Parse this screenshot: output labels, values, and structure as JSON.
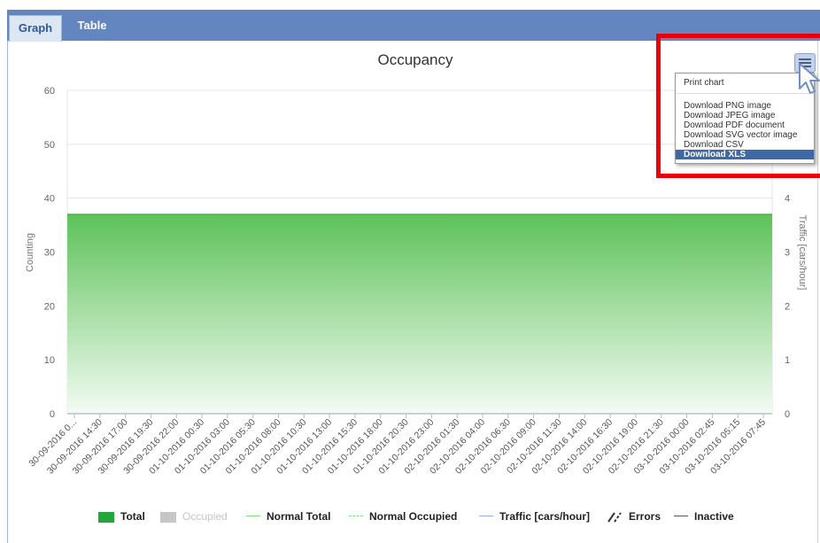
{
  "tabs": [
    {
      "label": "Graph",
      "active": true
    },
    {
      "label": "Table",
      "active": false
    }
  ],
  "export_menu": {
    "button_icon": "hamburger-menu-icon",
    "items": [
      {
        "label": "Print chart",
        "selected": false
      },
      {
        "label": "Download PNG image",
        "selected": false
      },
      {
        "label": "Download JPEG image",
        "selected": false
      },
      {
        "label": "Download PDF document",
        "selected": false
      },
      {
        "label": "Download SVG vector image",
        "selected": false
      },
      {
        "label": "Download CSV",
        "selected": false
      },
      {
        "label": "Download XLS",
        "selected": true
      }
    ]
  },
  "highlight_color": "#e8000b",
  "chart_data": {
    "type": "area",
    "title": "Occupancy",
    "ylabel": "Counting",
    "y2label": "Traffic [cars/hour]",
    "ylim": [
      0,
      60
    ],
    "yticks": [
      0,
      10,
      20,
      30,
      40,
      50,
      60
    ],
    "y2lim": [
      0,
      6
    ],
    "y2ticks": [
      0,
      1,
      2,
      3,
      4
    ],
    "grid": true,
    "legend_position": "bottom",
    "x": [
      "30-09-2016 0...",
      "30-09-2016 14:30",
      "30-09-2016 17:00",
      "30-09-2016 19:30",
      "30-09-2016 22:00",
      "01-10-2016 00:30",
      "01-10-2016 03:00",
      "01-10-2016 05:30",
      "01-10-2016 08:00",
      "01-10-2016 10:30",
      "01-10-2016 13:00",
      "01-10-2016 15:30",
      "01-10-2016 18:00",
      "01-10-2016 20:30",
      "01-10-2016 23:00",
      "02-10-2016 01:30",
      "02-10-2016 04:00",
      "02-10-2016 06:30",
      "02-10-2016 09:00",
      "02-10-2016 11:30",
      "02-10-2016 14:00",
      "02-10-2016 16:30",
      "02-10-2016 19:00",
      "02-10-2016 21:30",
      "03-10-2016 00:00",
      "03-10-2016 02:45",
      "03-10-2016 05:15",
      "03-10-2016 07:45"
    ],
    "series": [
      {
        "name": "Total",
        "color": "#22a63a",
        "values": [
          37,
          37,
          37,
          37,
          37,
          37,
          37,
          37,
          37,
          37,
          37,
          37,
          37,
          37,
          37,
          37,
          37,
          37,
          37,
          37,
          37,
          37,
          37,
          37,
          37,
          37,
          37,
          37
        ]
      },
      {
        "name": "Occupied",
        "color": "#c6c6c6",
        "values": [
          0,
          0,
          0,
          0,
          0,
          0,
          0,
          0,
          0,
          0,
          0,
          0,
          0,
          0,
          0,
          0,
          0,
          0,
          0,
          0,
          0,
          0,
          0,
          0,
          0,
          0,
          0,
          0
        ]
      },
      {
        "name": "Normal Total",
        "color": "#7de07d"
      },
      {
        "name": "Normal Occupied",
        "color": "#7de07d"
      },
      {
        "name": "Traffic [cars/hour]",
        "color": "#8fb5e3",
        "values": [
          0,
          0,
          0,
          0,
          0,
          0,
          0,
          0,
          0,
          0,
          0,
          0,
          0,
          0,
          0,
          0,
          0,
          0,
          0,
          0,
          0,
          0,
          0,
          0,
          0,
          0,
          0,
          0
        ]
      },
      {
        "name": "Errors",
        "color": "#333333"
      },
      {
        "name": "Inactive",
        "color": "#555555"
      }
    ]
  }
}
